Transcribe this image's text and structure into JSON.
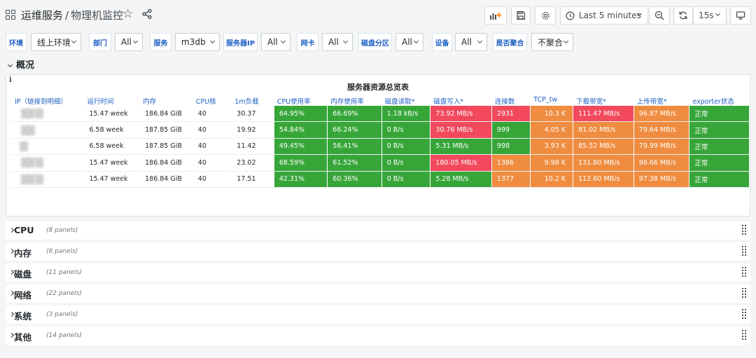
{
  "header": {
    "folder": "运维服务",
    "separator": "/",
    "title": "物理机监控"
  },
  "toolbar": {
    "time_range": "Last 5 minutes",
    "refresh_interval": "15s"
  },
  "variables": [
    {
      "label": "环境",
      "value": "线上环境"
    },
    {
      "label": "部门",
      "value": "All"
    },
    {
      "label": "服务",
      "value": "m3db"
    },
    {
      "label": "服务器IP",
      "value": "All"
    },
    {
      "label": "网卡",
      "value": "All"
    },
    {
      "label": "磁盘分区",
      "value": "All"
    },
    {
      "label": "设备",
      "value": "All"
    },
    {
      "label": "是否聚合",
      "value": "不聚合"
    }
  ],
  "overview": {
    "row_title": "概况",
    "panel_info": "i",
    "panel_title": "服务器资源总览表",
    "columns": [
      "IP（链接到明细）",
      "运行时间",
      "内存",
      "CPU核",
      "1m负载",
      "CPU使用率",
      "内存使用率",
      "磁盘读取*",
      "磁盘写入*",
      "连接数",
      "TCP_tw",
      "下载带宽*",
      "上传带宽*",
      "exporter状态"
    ],
    "rows": [
      [
        "",
        "15.47 week",
        "186.84 GiB",
        "40",
        "30.37",
        "64.95%",
        "66.69%",
        "1.18 kB/s",
        "73.92 MB/s",
        "2931",
        "10.3 K",
        "111.47 MB/s",
        "96.87 MB/s",
        "正常"
      ],
      [
        "",
        "6.58 week",
        "187.85 GiB",
        "40",
        "19.92",
        "54.84%",
        "66.24%",
        "0 B/s",
        "30.76 MB/s",
        "999",
        "4.05 K",
        "81.02 MB/s",
        "79.64 MB/s",
        "正常"
      ],
      [
        "",
        "6.58 week",
        "187.85 GiB",
        "40",
        "11.42",
        "49.45%",
        "56.41%",
        "0 B/s",
        "5.31 MB/s",
        "998",
        "3.93 K",
        "85.52 MB/s",
        "79.99 MB/s",
        "正常"
      ],
      [
        "",
        "15.47 week",
        "186.84 GiB",
        "40",
        "23.02",
        "68.59%",
        "61.52%",
        "0 B/s",
        "180.05 MB/s",
        "1386",
        "9.98 K",
        "131.80 MB/s",
        "98.66 MB/s",
        "正常"
      ],
      [
        "",
        "15.47 week",
        "186.84 GiB",
        "40",
        "17.51",
        "42.31%",
        "60.36%",
        "0 B/s",
        "5.28 MB/s",
        "1377",
        "10.2 K",
        "112.60 MB/s",
        "97.38 MB/s",
        "正常"
      ]
    ],
    "cell_colors": [
      [
        "plain",
        "plain",
        "plain",
        "plain",
        "plain",
        "green",
        "green",
        "green",
        "red",
        "red",
        "orange",
        "red",
        "orange",
        "green"
      ],
      [
        "plain",
        "plain",
        "plain",
        "plain",
        "plain",
        "green",
        "green",
        "green",
        "red",
        "green",
        "orange",
        "orange",
        "orange",
        "green"
      ],
      [
        "plain",
        "plain",
        "plain",
        "plain",
        "plain",
        "green",
        "green",
        "green",
        "green",
        "green",
        "orange",
        "orange",
        "orange",
        "green"
      ],
      [
        "plain",
        "plain",
        "plain",
        "plain",
        "plain",
        "green",
        "green",
        "green",
        "red",
        "orange",
        "orange",
        "orange",
        "orange",
        "green"
      ],
      [
        "plain",
        "plain",
        "plain",
        "plain",
        "plain",
        "green",
        "green",
        "green",
        "green",
        "orange",
        "orange",
        "orange",
        "orange",
        "green"
      ]
    ],
    "colors": {
      "green": "#37a639",
      "red": "#f2495c",
      "orange": "#ef8c3f"
    }
  },
  "collapsed_rows": [
    {
      "title": "CPU",
      "count": "(8 panels)"
    },
    {
      "title": "内存",
      "count": "(6 panels)"
    },
    {
      "title": "磁盘",
      "count": "(11 panels)"
    },
    {
      "title": "网络",
      "count": "(22 panels)"
    },
    {
      "title": "系统",
      "count": "(3 panels)"
    },
    {
      "title": "其他",
      "count": "(14 panels)"
    }
  ]
}
